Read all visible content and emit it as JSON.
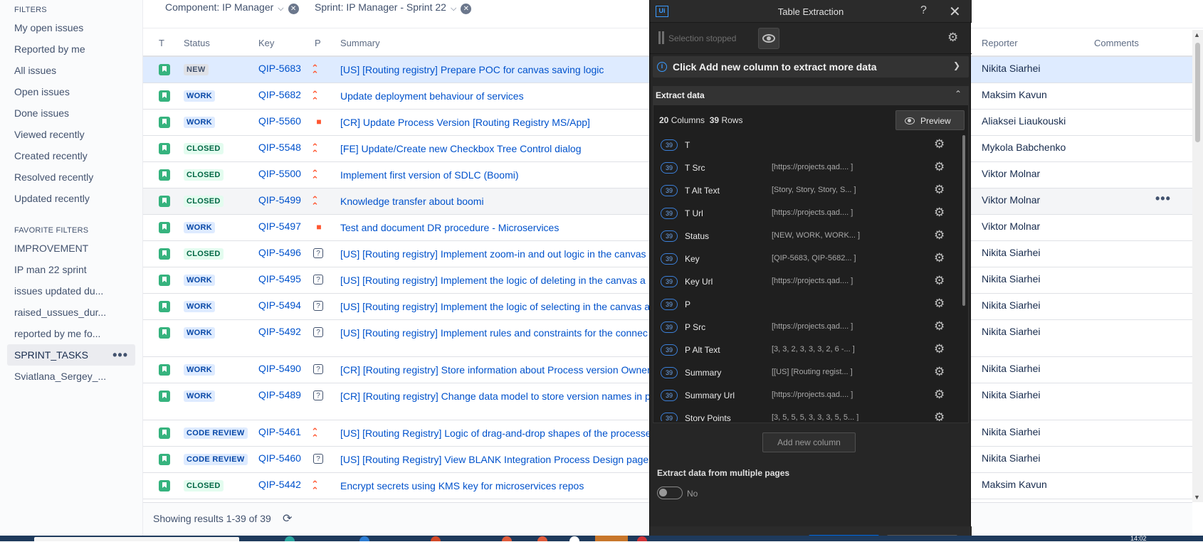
{
  "sidebar": {
    "filters_heading": "FILTERS",
    "filters": [
      "My open issues",
      "Reported by me",
      "All issues",
      "Open issues",
      "Done issues",
      "Viewed recently",
      "Created recently",
      "Resolved recently",
      "Updated recently"
    ],
    "favorites_heading": "FAVORITE FILTERS",
    "favorites": [
      "IMPROVEMENT",
      "IP man 22 sprint",
      "issues updated du...",
      "raised_ussues_dur...",
      "reported by me fo...",
      "SPRINT_TASKS",
      "Sviatlana_Sergey_..."
    ],
    "selected_favorite": "SPRINT_TASKS",
    "more_glyph": "•••"
  },
  "filterbar": {
    "component": "Component: IP Manager",
    "sprint": "Sprint: IP Manager - Sprint 22"
  },
  "table": {
    "headers": {
      "t": "T",
      "status": "Status",
      "key": "Key",
      "p": "P",
      "summary": "Summary",
      "reporter": "Reporter",
      "comments": "Comments"
    },
    "rows": [
      {
        "status": "NEW",
        "key": "QIP-5683",
        "priority": "highest",
        "summary": "[US] [Routing registry] Prepare POC for canvas saving logic",
        "reporter": "Nikita Siarhei"
      },
      {
        "status": "WORK",
        "key": "QIP-5682",
        "priority": "highest",
        "summary": "Update deployment behaviour of services",
        "reporter": "Maksim Kavun"
      },
      {
        "status": "WORK",
        "key": "QIP-5560",
        "priority": "blocker",
        "summary": "[CR] Update Process Version [Routing Registry MS/App]",
        "reporter": "Aliaksei Liaukouski"
      },
      {
        "status": "CLOSED",
        "key": "QIP-5548",
        "priority": "highest",
        "summary": "[FE] Update/Create new Checkbox Tree Control dialog",
        "reporter": "Mykola Babchenko"
      },
      {
        "status": "CLOSED",
        "key": "QIP-5500",
        "priority": "highest",
        "summary": "Implement first version of SDLC (Boomi)",
        "reporter": "Viktor Molnar"
      },
      {
        "status": "CLOSED",
        "key": "QIP-5499",
        "priority": "highest",
        "summary": "Knowledge transfer about boomi",
        "reporter": "Viktor Molnar"
      },
      {
        "status": "WORK",
        "key": "QIP-5497",
        "priority": "blocker",
        "summary": "Test and document DR procedure - Microservices",
        "reporter": "Viktor Molnar"
      },
      {
        "status": "CLOSED",
        "key": "QIP-5496",
        "priority": "unknown",
        "summary": "[US] [Routing registry] Implement zoom-in and out logic in the canvas",
        "reporter": "Nikita Siarhei"
      },
      {
        "status": "WORK",
        "key": "QIP-5495",
        "priority": "unknown",
        "summary": "[US] [Routing registry] Implement the logic of deleting in the canvas a",
        "reporter": "Nikita Siarhei"
      },
      {
        "status": "WORK",
        "key": "QIP-5494",
        "priority": "unknown",
        "summary": "[US] [Routing registry] Implement the logic of selecting in the canvas a",
        "reporter": "Nikita Siarhei"
      },
      {
        "status": "WORK",
        "key": "QIP-5492",
        "priority": "unknown",
        "summary": "[US] [Routing registry] Implement rules and constraints for the connec (canvas area)",
        "reporter": "Nikita Siarhei"
      },
      {
        "status": "WORK",
        "key": "QIP-5490",
        "priority": "unknown",
        "summary": "[CR] [Routing registry] Store information about Process version Owner",
        "reporter": "Nikita Siarhei"
      },
      {
        "status": "WORK",
        "key": "QIP-5489",
        "priority": "unknown",
        "summary": "[CR] [Routing registry] Change data model to store version names in p process table",
        "reporter": "Nikita Siarhei"
      },
      {
        "status": "CODE REVIEW",
        "key": "QIP-5461",
        "priority": "highest",
        "summary": "[US] [Routing Registry] Logic of drag-and-drop shapes of the processe",
        "reporter": "Nikita Siarhei"
      },
      {
        "status": "CODE REVIEW",
        "key": "QIP-5460",
        "priority": "unknown",
        "summary": "[US] [Routing Registry] View BLANK Integration Process Design page (",
        "reporter": "Nikita Siarhei"
      },
      {
        "status": "CLOSED",
        "key": "QIP-5442",
        "priority": "highest",
        "summary": "Encrypt secrets using KMS key for microservices repos",
        "reporter": "Maksim Kavun"
      }
    ],
    "row_more_glyph": "•••",
    "footer": "Showing results 1-39 of 39"
  },
  "dialog": {
    "logo": "Ui",
    "title": "Table Extraction",
    "help": "?",
    "close": "✕",
    "selection_status": "Selection stopped",
    "info": "Click Add new column to extract more data",
    "extract_heading": "Extract data",
    "columns_count": "20",
    "columns_label": "Columns",
    "rows_count": "39",
    "rows_label": "Rows",
    "preview_label": "Preview",
    "columns": [
      {
        "count": "39",
        "name": "T",
        "preview": ""
      },
      {
        "count": "39",
        "name": "T Src",
        "preview": "[https://projects.qad.... ]"
      },
      {
        "count": "39",
        "name": "T Alt Text",
        "preview": "[Story, Story, Story, S... ]"
      },
      {
        "count": "39",
        "name": "T Url",
        "preview": "[https://projects.qad.... ]"
      },
      {
        "count": "39",
        "name": "Status",
        "preview": "[NEW, WORK, WORK... ]"
      },
      {
        "count": "39",
        "name": "Key",
        "preview": "[QIP-5683, QIP-5682... ]"
      },
      {
        "count": "39",
        "name": "Key Url",
        "preview": "[https://projects.qad.... ]"
      },
      {
        "count": "39",
        "name": "P",
        "preview": ""
      },
      {
        "count": "39",
        "name": "P Src",
        "preview": "[https://projects.qad.... ]"
      },
      {
        "count": "39",
        "name": "P Alt Text",
        "preview": "[3, 3, 2, 3, 3, 3, 2, 6 -... ]"
      },
      {
        "count": "39",
        "name": "Summary",
        "preview": "[[US] [Routing regist... ]"
      },
      {
        "count": "39",
        "name": "Summary Url",
        "preview": "[https://projects.qad.... ]"
      },
      {
        "count": "39",
        "name": "Story Points",
        "preview": "[3, 5, 5, 5, 3, 3, 3, 5, 5... ]"
      }
    ],
    "add_column_label": "Add new column",
    "multi_page_label": "Extract data from multiple pages",
    "multi_page_value": "No"
  },
  "taskbar": {
    "clock": "14:02"
  },
  "colors": {
    "accent": "#0052cc",
    "dialog_bg": "#262626",
    "highlight_row": "#deebff"
  }
}
